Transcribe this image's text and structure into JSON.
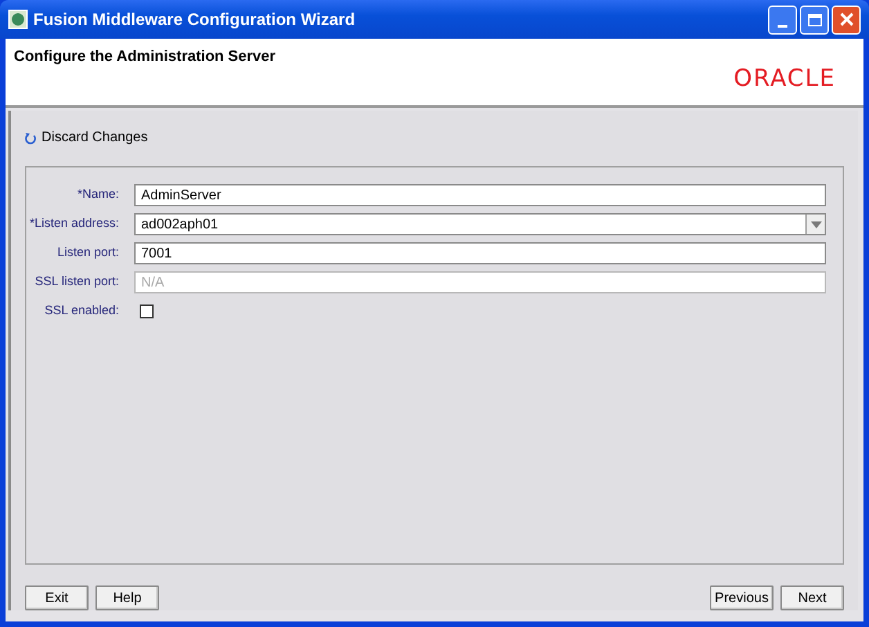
{
  "window": {
    "title": "Fusion Middleware Configuration Wizard"
  },
  "header": {
    "title": "Configure the Administration Server",
    "logo": "ORACLE"
  },
  "discard": {
    "label": "Discard Changes"
  },
  "fields": [
    {
      "kind": "text",
      "label": "*Name:",
      "value": "AdminServer",
      "disabled": false
    },
    {
      "kind": "combo",
      "label": "*Listen address:",
      "value": "ad002aph01",
      "disabled": false
    },
    {
      "kind": "text",
      "label": "Listen port:",
      "value": "7001",
      "disabled": false
    },
    {
      "kind": "text",
      "label": "SSL listen port:",
      "placeholder": "N/A",
      "disabled": true
    },
    {
      "kind": "checkbox",
      "label": "SSL enabled:",
      "checked": false
    }
  ],
  "buttons_left": [
    "Exit",
    "Help"
  ],
  "buttons_right": [
    "Previous",
    "Next"
  ]
}
